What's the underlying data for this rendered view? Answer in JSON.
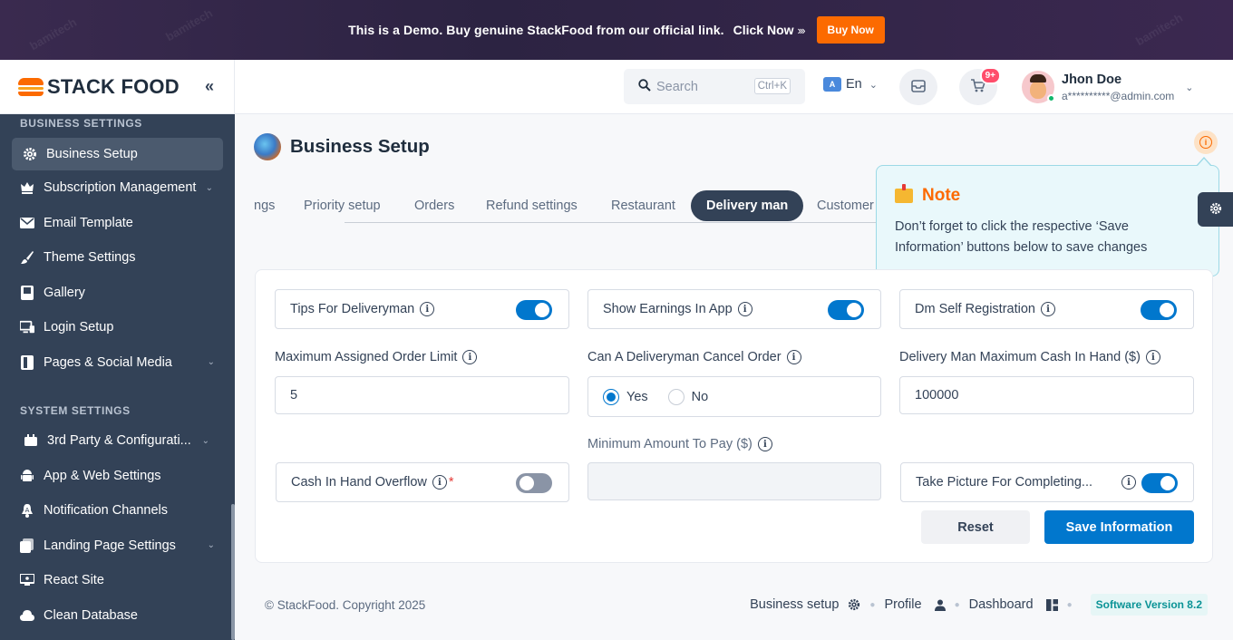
{
  "banner": {
    "text": "This is a Demo. Buy genuine StackFood from our official link.",
    "link": "Click Now",
    "arrows": "›››",
    "buy_label": "Buy Now",
    "watermark": "bamitech"
  },
  "brand": {
    "name": "STACK FOOD",
    "collapse_icon": "«"
  },
  "sidebar": {
    "sections": [
      {
        "title": "BUSINESS SETTINGS",
        "items": [
          {
            "label": "Business Setup",
            "icon": "gear-icon",
            "active": true
          },
          {
            "label": "Subscription Management",
            "icon": "subscription-icon",
            "chevron": true
          },
          {
            "label": "Email Template",
            "icon": "email-icon"
          },
          {
            "label": "Theme Settings",
            "icon": "brush-icon"
          },
          {
            "label": "Gallery",
            "icon": "gallery-icon"
          },
          {
            "label": "Login Setup",
            "icon": "login-icon"
          },
          {
            "label": "Pages & Social Media",
            "icon": "pages-icon",
            "chevron": true
          }
        ]
      },
      {
        "title": "SYSTEM SETTINGS",
        "items": [
          {
            "label": "3rd Party & Configurati...",
            "icon": "plugin-icon",
            "chevron": true
          },
          {
            "label": "App & Web Settings",
            "icon": "android-icon"
          },
          {
            "label": "Notification Channels",
            "icon": "bell-icon"
          },
          {
            "label": "Landing Page Settings",
            "icon": "landing-icon",
            "chevron": true
          },
          {
            "label": "React Site",
            "icon": "react-icon"
          },
          {
            "label": "Clean Database",
            "icon": "database-icon"
          }
        ]
      }
    ]
  },
  "topbar": {
    "search_placeholder": "Search",
    "search_shortcut": "Ctrl+K",
    "language": "En",
    "cart_badge": "9+",
    "user_name": "Jhon Doe",
    "user_email": "a**********@admin.com"
  },
  "page": {
    "title": "Business Setup",
    "tabs": [
      "ngs",
      "Priority setup",
      "Orders",
      "Refund settings",
      "Restaurant",
      "Delivery man",
      "Customer"
    ],
    "active_tab": "Delivery man"
  },
  "note": {
    "title": "Note",
    "body": "Don’t forget to click the respective ‘Save Information’ buttons below to save changes"
  },
  "form": {
    "tips_label": "Tips For Deliveryman",
    "tips_on": true,
    "earnings_label": "Show Earnings In App",
    "earnings_on": true,
    "self_reg_label": "Dm Self Registration",
    "self_reg_on": true,
    "max_order_label": "Maximum Assigned Order Limit",
    "max_order_value": "5",
    "cancel_label": "Can A Deliveryman Cancel Order",
    "cancel_yes": "Yes",
    "cancel_no": "No",
    "cancel_selected": "Yes",
    "cash_hand_label": "Delivery Man Maximum Cash In Hand ($)",
    "cash_hand_value": "100000",
    "min_pay_label": "Minimum Amount To Pay ($)",
    "min_pay_value": "",
    "overflow_label": "Cash In Hand Overflow",
    "overflow_required": "*",
    "overflow_on": false,
    "picture_label": "Take Picture For Completing...",
    "picture_on": true,
    "reset_label": "Reset",
    "save_label": "Save Information",
    "info_glyph": "i"
  },
  "footer": {
    "copyright": "© StackFood. Copyright 2025",
    "links": [
      "Business setup",
      "Profile",
      "Dashboard"
    ],
    "version": "Software Version 8.2"
  }
}
